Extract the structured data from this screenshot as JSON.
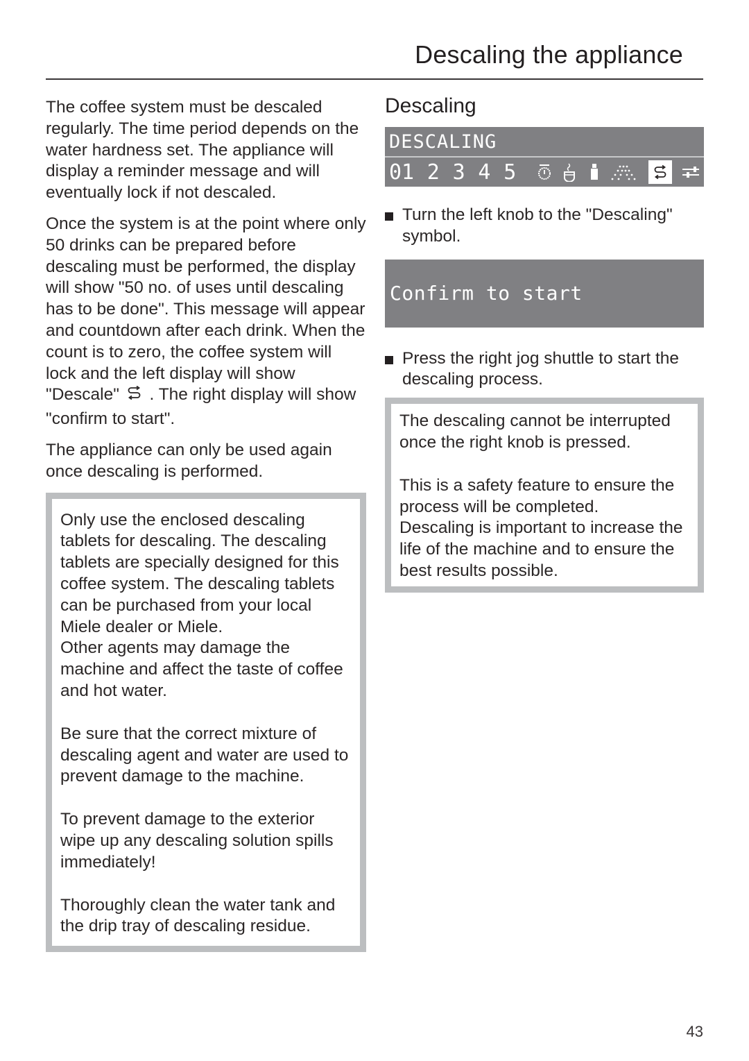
{
  "header": {
    "title": "Descaling the appliance"
  },
  "left_column": {
    "paragraphs": [
      "The coffee system must be descaled regularly. The time period depends on the water hardness set. The appliance will display a reminder message and will eventually lock if not descaled.",
      "The appliance can only be used again once descaling is performed."
    ],
    "countdown_paragraph": {
      "before_icon": "Once the system is at the point where only 50 drinks can be prepared before descaling must be performed, the display will show \"50 no. of uses until descaling has to be done\". This message will appear and countdown after each drink. When the count is to zero, the coffee system will lock and the left display will show \"Descale\"",
      "icon": "descale-icon",
      "after_icon": ". The right display will show \"confirm to start\"."
    },
    "warning_box": {
      "paragraphs": [
        "Only use the enclosed descaling tablets  for descaling. The descaling tablets are specially designed for this coffee system. The descaling tablets can be purchased from your local Miele dealer or Miele.\nOther agents may damage the machine and affect the taste of coffee and hot water.",
        "Be sure that the correct mixture of descaling agent and water are used to prevent damage to the machine.",
        "To prevent damage to the exterior wipe up any descaling solution spills immediately!",
        "Thoroughly clean the water tank and the drip tray of descaling residue."
      ]
    }
  },
  "right_column": {
    "heading": "Descaling",
    "display_menu": {
      "top_text": "DESCALING",
      "numbers": [
        "01",
        "2",
        "3",
        "4",
        "5"
      ],
      "icons": [
        "timer-icon",
        "cup-icon",
        "person-icon",
        "spray-icon",
        "descale-icon",
        "settings-sliders-icon"
      ],
      "active_icon": "descale-icon"
    },
    "steps": [
      "Turn the left knob to the \"Descaling\" symbol.",
      "Press the right jog shuttle to start the descaling process."
    ],
    "display_confirm": {
      "text": "Confirm to start"
    },
    "info_box": {
      "paragraphs": [
        "The descaling cannot be interrupted once the right knob is pressed.",
        "This is a safety feature to ensure the process will be completed.\nDescaling is important to increase the life of the machine and to ensure the best results possible."
      ]
    }
  },
  "footer": {
    "page_number": "43"
  },
  "colors": {
    "display_background": "#808083",
    "box_border": "#bcbec0",
    "text": "#2a2626"
  }
}
